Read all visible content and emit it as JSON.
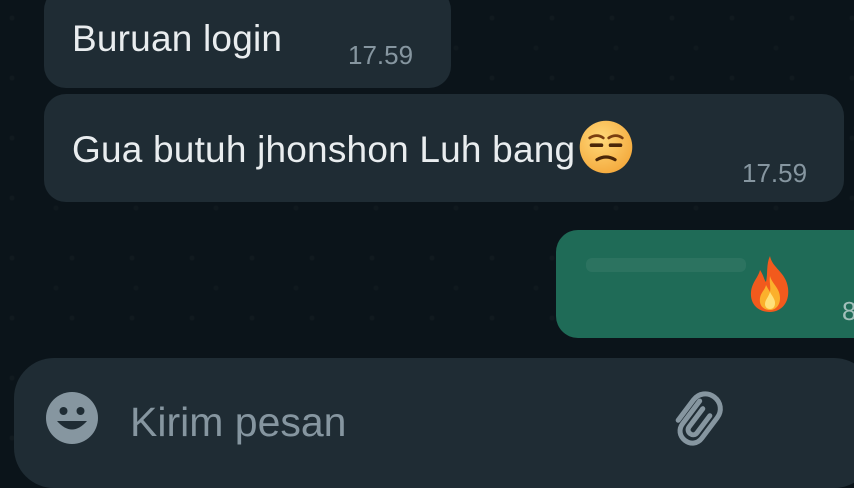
{
  "messages": [
    {
      "direction": "incoming",
      "text": "Buruan login",
      "time": "17.59"
    },
    {
      "direction": "incoming",
      "text": "Gua butuh jhonshon Luh bang",
      "emoji": "unamused-face",
      "time": "17.59"
    },
    {
      "direction": "outgoing",
      "emoji": "fire",
      "time": "8"
    }
  ],
  "composer": {
    "placeholder": "Kirim pesan",
    "emoji_icon": "smiley-icon",
    "attach_icon": "paperclip-icon"
  },
  "colors": {
    "background": "#0b141a",
    "incoming_bubble": "#1f2c34",
    "outgoing_bubble": "#1f6b57",
    "text": "#e9edef",
    "meta": "#8696a0"
  }
}
